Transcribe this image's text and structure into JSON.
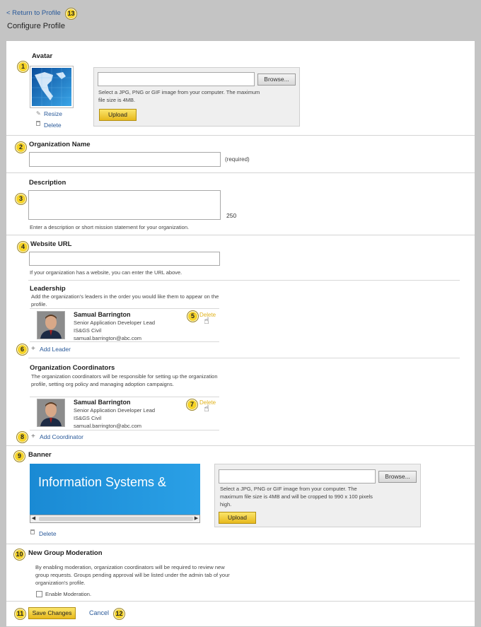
{
  "header": {
    "return_link": "< Return to Profile",
    "title": "Configure Profile"
  },
  "avatar": {
    "label": "Avatar",
    "resize_link": "Resize",
    "delete_link": "Delete",
    "file_value": "",
    "browse_label": "Browse...",
    "help": "Select a JPG, PNG or GIF image from your computer.  The maximum file size is 4MB.",
    "upload_label": "Upload"
  },
  "org_name": {
    "label": "Organization Name",
    "value": "",
    "required_text": "(required)"
  },
  "description": {
    "label": "Description",
    "value": "",
    "char_count": "250",
    "help": "Enter a description or short mission statement for your organization."
  },
  "website": {
    "label": "Website URL",
    "value": "",
    "help": "If your organization has a website, you can enter the URL above."
  },
  "leadership": {
    "label": "Leadership",
    "help": "Add the organization's leaders in the order you would like them to appear on the profile.",
    "person": {
      "name": "Samual Barrington",
      "title": "Senior Application Developer Lead",
      "dept": "IS&GS Civil",
      "email": "samual.barrington@abc.com",
      "delete_label": "Delete"
    },
    "add_label": "Add Leader"
  },
  "coordinators": {
    "label": "Organization Coordinators",
    "help": "The organization coordinators will be responsible for setting up the organization profile, setting org policy and managing adoption campaigns.",
    "person": {
      "name": "Samual Barrington",
      "title": "Senior Application Developer Lead",
      "dept": "IS&GS Civil",
      "email": "samual.barrington@abc.com",
      "delete_label": "Delete"
    },
    "add_label": "Add Coordinator"
  },
  "banner": {
    "label": "Banner",
    "image_text": "Information Systems &",
    "delete_link": "Delete",
    "file_value": "",
    "browse_label": "Browse...",
    "help": "Select a JPG, PNG or GIF image from your computer.  The maximum file size is 4MB and will be cropped to 990 x 100 pixels high.",
    "upload_label": "Upload"
  },
  "moderation": {
    "label": "New Group Moderation",
    "help": "By enabling moderation, organization coordinators will be required to review new group requests.  Groups pending approval will be listed under the admin tab of your organization's profile.",
    "checkbox_label": "Enable Moderation.",
    "checked": false
  },
  "footer": {
    "save_label": "Save Changes",
    "cancel_label": "Cancel"
  },
  "badges": [
    "1",
    "2",
    "3",
    "4",
    "5",
    "6",
    "7",
    "8",
    "9",
    "10",
    "11",
    "12",
    "13"
  ],
  "colors": {
    "badge": "#f5d328",
    "link": "#2a5a9a",
    "delete": "#e0b21c",
    "banner": "#1d8fd6"
  }
}
